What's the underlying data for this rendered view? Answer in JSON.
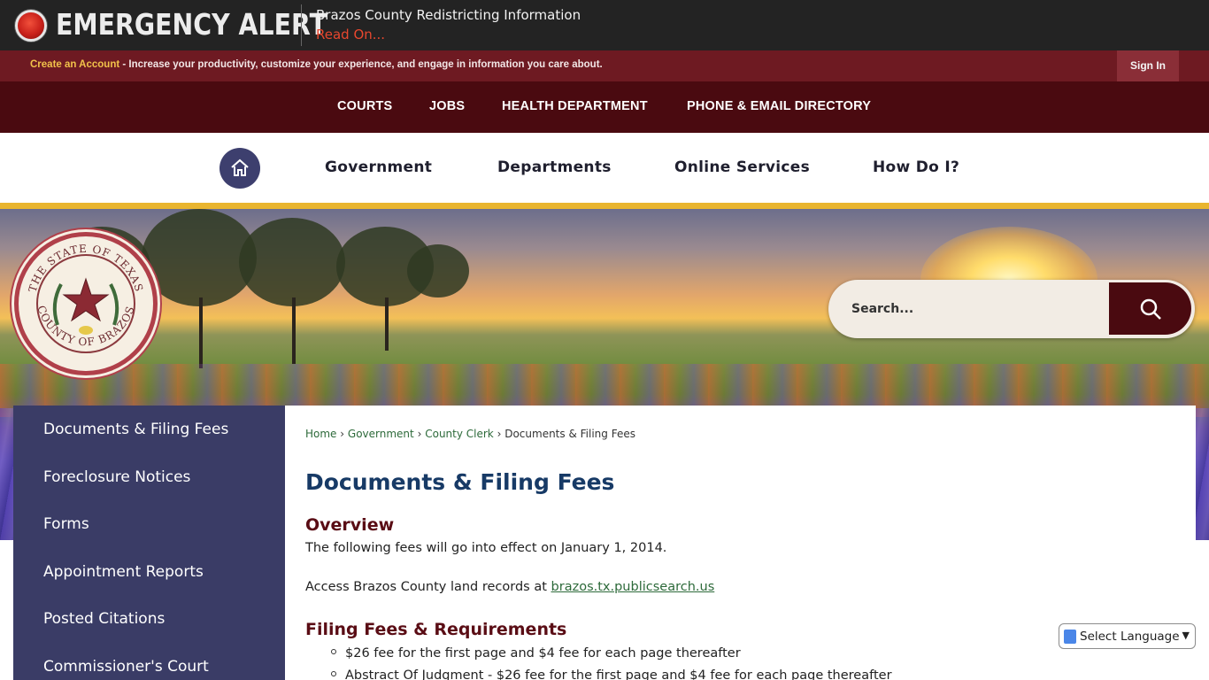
{
  "alert": {
    "title": "EMERGENCY ALERT",
    "headline": "Brazos County Redistricting Information",
    "link": "Read On..."
  },
  "account": {
    "create_link": "Create an Account",
    "text": " - Increase your productivity, customize your experience, and engage in information you care about.",
    "sign_in": "Sign In"
  },
  "quick_nav": [
    "COURTS",
    "JOBS",
    "HEALTH DEPARTMENT",
    "PHONE & EMAIL DIRECTORY"
  ],
  "main_nav": [
    "Government",
    "Departments",
    "Online Services",
    "How Do I?"
  ],
  "seal": {
    "top_text": "THE STATE OF TEXAS",
    "bottom_text": "COUNTY OF BRAZOS"
  },
  "search": {
    "placeholder": "Search..."
  },
  "sidebar": {
    "items": [
      "Documents & Filing Fees",
      "Foreclosure Notices",
      "Forms",
      "Appointment Reports",
      "Posted Citations",
      "Commissioner's Court"
    ]
  },
  "breadcrumb": {
    "items": [
      "Home",
      "Government",
      "County Clerk"
    ],
    "current": "Documents & Filing Fees",
    "separator": "›"
  },
  "content": {
    "title": "Documents & Filing Fees",
    "overview_heading": "Overview",
    "overview_text": "The following fees will go into effect on January 1, 2014.",
    "access_text": "Access Brazos County land records at ",
    "access_link": "brazos.tx.publicsearch.us",
    "filing_heading": "Filing Fees & Requirements",
    "bullets": [
      "$26 fee for the first page and $4 fee for each page thereafter",
      "Abstract Of Judgment - $26 fee for the first page and $4 fee for each page thereafter"
    ]
  },
  "translate": {
    "label": "Select Language"
  },
  "colors": {
    "alert_bg": "#232323",
    "account_bg": "#6e1a22",
    "quick_nav_bg": "#4a0a10",
    "accent_gold": "#e9b52f",
    "sidebar_bg": "#3a3c66",
    "title_blue": "#173a66",
    "heading_maroon": "#5a0d15",
    "link_green": "#2d6a3a",
    "alert_link": "#e8472e"
  }
}
